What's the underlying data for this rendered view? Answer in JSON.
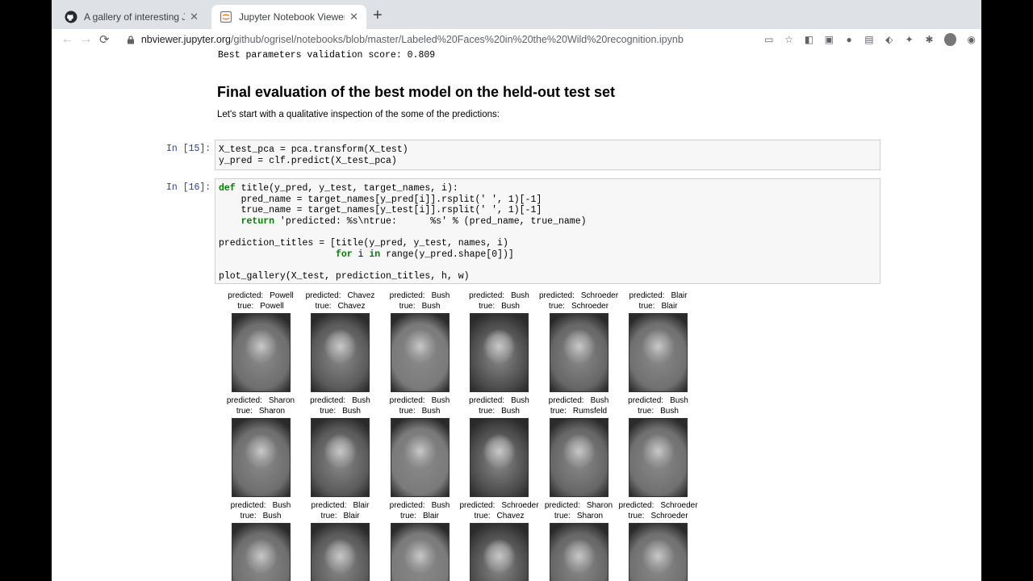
{
  "browser": {
    "tabs": [
      {
        "title": "A gallery of interesting Jupyter",
        "active": false,
        "icon": "github-icon"
      },
      {
        "title": "Jupyter Notebook Viewer",
        "active": true,
        "icon": "jupyter-icon"
      }
    ],
    "url_host": "nbviewer.jupyter.org",
    "url_path": "/github/ogrisel/notebooks/blob/master/Labeled%20Faces%20in%20the%20Wild%20recognition.ipynb"
  },
  "notebook": {
    "score_line": "Best parameters validation score: 0.809",
    "heading": "Final evaluation of the best model on the held-out test set",
    "intro": "Let's start with a qualitative inspection of the some of the predictions:",
    "cell15": {
      "prompt": "In [15]:",
      "code": "X_test_pca = pca.transform(X_test)\ny_pred = clf.predict(X_test_pca)"
    },
    "cell16": {
      "prompt": "In [16]:",
      "code": "def title(y_pred, y_test, target_names, i):\n    pred_name = target_names[y_pred[i]].rsplit(' ', 1)[-1]\n    true_name = target_names[y_test[i]].rsplit(' ', 1)[-1]\n    return 'predicted: %s\\ntrue:      %s' % (pred_name, true_name)\n\nprediction_titles = [title(y_pred, y_test, names, i)\n                     for i in range(y_pred.shape[0])]\n\nplot_gallery(X_test, prediction_titles, h, w)"
    },
    "gallery": [
      {
        "predicted": "Powell",
        "true": "Powell"
      },
      {
        "predicted": "Chavez",
        "true": "Chavez"
      },
      {
        "predicted": "Bush",
        "true": "Bush"
      },
      {
        "predicted": "Bush",
        "true": "Bush"
      },
      {
        "predicted": "Schroeder",
        "true": "Schroeder"
      },
      {
        "predicted": "Blair",
        "true": "Blair"
      },
      {
        "predicted": "Sharon",
        "true": "Sharon"
      },
      {
        "predicted": "Bush",
        "true": "Bush"
      },
      {
        "predicted": "Bush",
        "true": "Bush"
      },
      {
        "predicted": "Bush",
        "true": "Bush"
      },
      {
        "predicted": "Bush",
        "true": "Rumsfeld"
      },
      {
        "predicted": "Bush",
        "true": "Bush"
      },
      {
        "predicted": "Bush",
        "true": "Bush"
      },
      {
        "predicted": "Blair",
        "true": "Blair"
      },
      {
        "predicted": "Bush",
        "true": "Blair"
      },
      {
        "predicted": "Schroeder",
        "true": "Chavez"
      },
      {
        "predicted": "Sharon",
        "true": "Sharon"
      },
      {
        "predicted": "Schroeder",
        "true": "Schroeder"
      }
    ],
    "caption_predicted": "predicted:",
    "caption_true": "true:"
  }
}
